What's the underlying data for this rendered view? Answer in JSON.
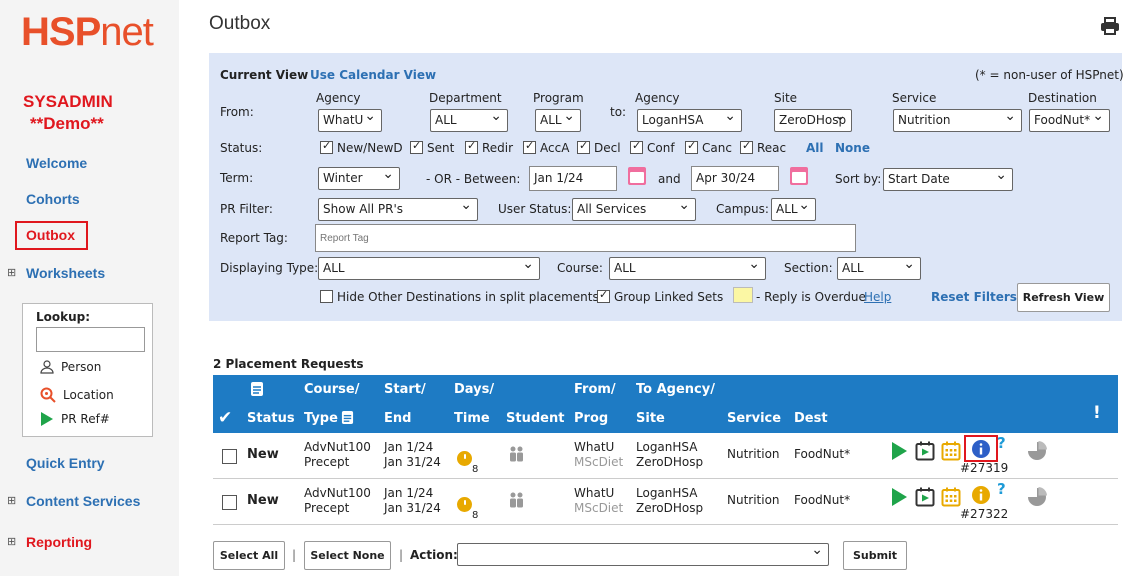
{
  "sidebar": {
    "logo": {
      "hsp": "HSP",
      "net": "net"
    },
    "role": "SYSADMIN",
    "demo": "**Demo**",
    "welcome": "Welcome",
    "cohorts": "Cohorts",
    "outbox": "Outbox",
    "worksheets": "Worksheets",
    "lookup": {
      "label": "Lookup:",
      "person": "Person",
      "location": "Location",
      "prref": "PR Ref#"
    },
    "quick_entry": "Quick Entry",
    "content_services": "Content Services",
    "reporting": "Reporting"
  },
  "page": {
    "title": "Outbox"
  },
  "filter": {
    "current_view": "Current View",
    "use_calendar": "Use Calendar View",
    "note": "(* = non-user of HSPnet)",
    "from_label": "From:",
    "to_label": "to:",
    "hdr": {
      "agency": "Agency",
      "department": "Department",
      "program": "Program",
      "to_agency": "Agency",
      "site": "Site",
      "service": "Service",
      "destination": "Destination"
    },
    "from_agency": "WhatU",
    "department": "ALL",
    "program": "ALL",
    "to_agency": "LoganHSA",
    "site": "ZeroDHosp",
    "service": "Nutrition",
    "destination": "FoodNut*",
    "status_label": "Status:",
    "statuses": [
      "New/NewD",
      "Sent",
      "Redir",
      "AccA",
      "Decl",
      "Conf",
      "Canc",
      "Reac"
    ],
    "all": "All",
    "none": "None",
    "term_label": "Term:",
    "term": "Winter",
    "or_between": "- OR -  Between:",
    "start": "Jan 1/24",
    "and": "and",
    "end": "Apr 30/24",
    "sort_label": "Sort by:",
    "sort": "Start Date",
    "pr_filter_label": "PR Filter:",
    "pr_filter": "Show All PR's",
    "user_status_label": "User Status:",
    "user_status": "All Services",
    "campus_label": "Campus:",
    "campus": "ALL",
    "report_tag_label": "Report Tag:",
    "report_tag_placeholder": "Report Tag",
    "displaying_type_label": "Displaying Type:",
    "displaying_type": "ALL",
    "course_label": "Course:",
    "course": "ALL",
    "section_label": "Section:",
    "section": "ALL",
    "hide_other": "Hide Other Destinations in split placements",
    "group_linked": "Group Linked Sets",
    "overdue": "- Reply is Overdue",
    "help": "Help",
    "reset": "Reset Filters",
    "refresh": "Refresh View",
    "overdue_color": "#fbf7a4"
  },
  "table": {
    "count": "2 Placement Requests",
    "headers": {
      "status": "Status",
      "course1": "Course/",
      "course2": "Type",
      "start1": "Start/",
      "start2": "End",
      "days1": "Days/",
      "days2": "Time",
      "student": "Student",
      "from1": "From/",
      "from2": "Prog",
      "to1": "To Agency/",
      "to2": "Site",
      "service": "Service",
      "dest": "Dest",
      "alert": "!"
    },
    "rows": [
      {
        "status": "New",
        "course": "AdvNut100",
        "type": "Precept",
        "start": "Jan 1/24",
        "end": "Jan 31/24",
        "days": "8",
        "from": "WhatU",
        "prog": "MScDiet",
        "to": "LoganHSA",
        "site": "ZeroDHosp",
        "service": "Nutrition",
        "dest": "FoodNut*",
        "ref": "#27319",
        "info_color": "#2d5fc7"
      },
      {
        "status": "New",
        "course": "AdvNut100",
        "type": "Precept",
        "start": "Jan 1/24",
        "end": "Jan 31/24",
        "days": "8",
        "from": "WhatU",
        "prog": "MScDiet",
        "to": "LoganHSA",
        "site": "ZeroDHosp",
        "service": "Nutrition",
        "dest": "FoodNut*",
        "ref": "#27322",
        "info_color": "#e8a900"
      }
    ]
  },
  "actions": {
    "select_all": "Select All",
    "select_none": "Select None",
    "sep": "|",
    "action_label": "Action:",
    "submit": "Submit"
  },
  "colors": {
    "header_bar": "#1e7bc4",
    "filter_bg": "#dde6f7",
    "nav_blue": "#2d70b3",
    "alert_red": "#e0171e",
    "brand": "#e8502a"
  }
}
